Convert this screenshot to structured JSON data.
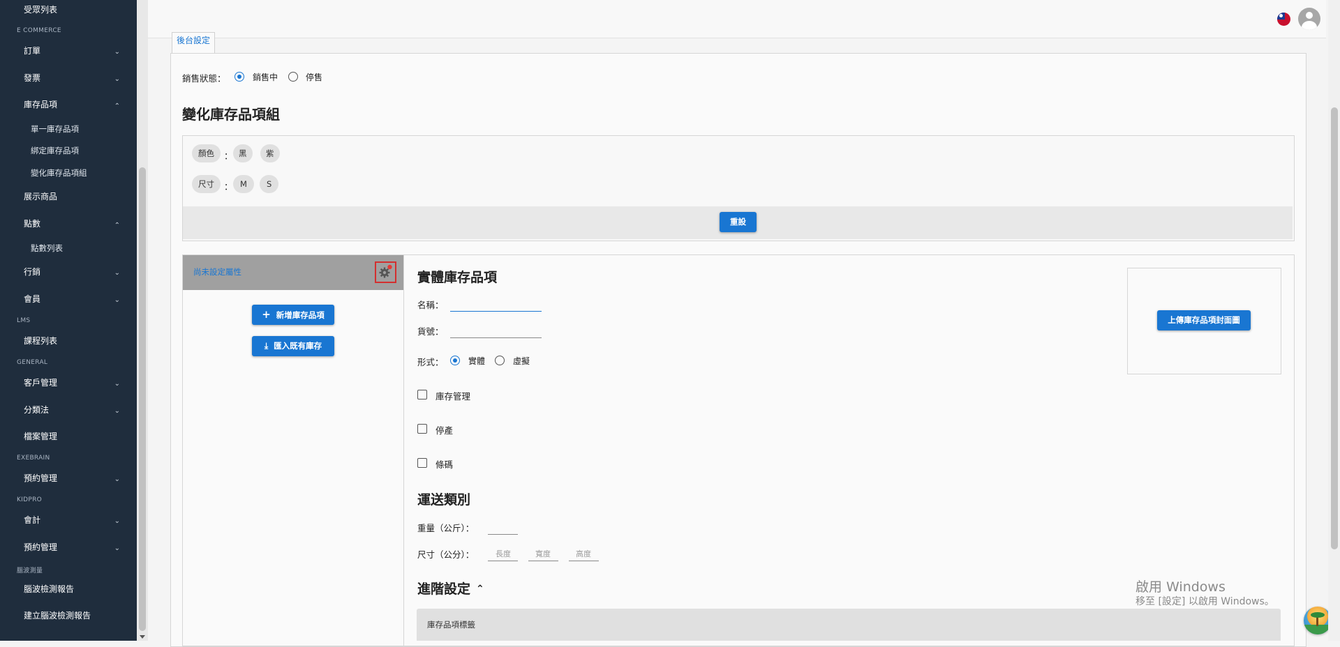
{
  "sidebar": {
    "top_item": "受眾列表",
    "sections": {
      "ecommerce": "E COMMERCE",
      "lms": "LMS",
      "general": "GENERAL",
      "exebrain": "EXEBRAIN",
      "kidpro": "KIDPRO",
      "eeg": "腦波測量"
    },
    "items": {
      "orders": "訂單",
      "invoices": "發票",
      "inventory": "庫存品項",
      "inventory_single": "單一庫存品項",
      "inventory_bundle": "綁定庫存品項",
      "inventory_variant": "變化庫存品項組",
      "display_products": "展示商品",
      "points": "點數",
      "points_list": "點數列表",
      "marketing": "行銷",
      "members": "會員",
      "courses": "課程列表",
      "customers": "客戶管理",
      "taxonomy": "分類法",
      "files": "檔案管理",
      "booking_exebrain": "預約管理",
      "accounting": "會計",
      "booking_kidpro": "預約管理",
      "eeg_report": "腦波檢測報告",
      "eeg_create": "建立腦波檢測報告"
    }
  },
  "tab_label": "後台設定",
  "sale_status": {
    "label": "銷售狀態：",
    "options": [
      "銷售中",
      "停售"
    ],
    "selected": "銷售中"
  },
  "variant_group": {
    "title": "變化庫存品項組",
    "attributes": [
      {
        "name": "顏色",
        "values": [
          "黑",
          "紫"
        ]
      },
      {
        "name": "尺寸",
        "values": [
          "M",
          "S"
        ]
      }
    ],
    "colon": "：",
    "reset_button": "重設"
  },
  "left_list": {
    "unset_attr": "尚未設定屬性",
    "add_button": "新增庫存品項",
    "import_button": "匯入既有庫存"
  },
  "item_form": {
    "title": "實體庫存品項",
    "name_label": "名稱：",
    "sku_label": "貨號：",
    "type_label": "形式：",
    "type_options": [
      "實體",
      "虛擬"
    ],
    "type_selected": "實體",
    "checkboxes": [
      "庫存管理",
      "停產",
      "條碼"
    ],
    "upload_cover": "上傳庫存品項封面圖",
    "shipping_title": "運送類別",
    "weight_label": "重量（公斤）：",
    "size_label": "尺寸（公分）：",
    "size_placeholders": [
      "長度",
      "寬度",
      "高度"
    ],
    "advanced_title": "進階設定",
    "tags_label": "庫存品項標籤"
  },
  "watermark": {
    "line1": "啟用 Windows",
    "line2": "移至 [設定] 以啟用 Windows。"
  },
  "colors": {
    "sidebar_bg": "#1f2d3d",
    "accent": "#1976d2",
    "highlight_box": "#d32f2f"
  }
}
